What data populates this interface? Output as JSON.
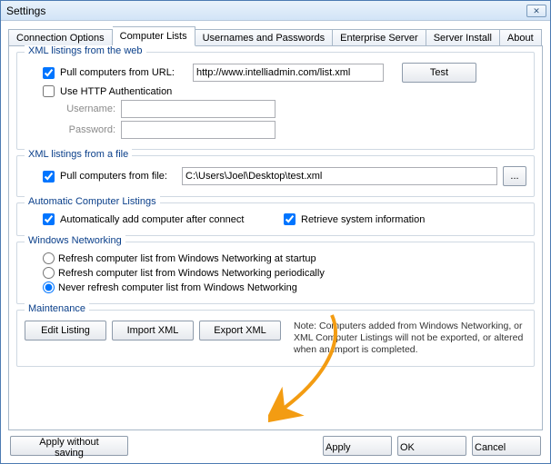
{
  "window": {
    "title": "Settings"
  },
  "tabs": [
    {
      "label": "Connection Options"
    },
    {
      "label": "Computer Lists"
    },
    {
      "label": "Usernames and Passwords"
    },
    {
      "label": "Enterprise Server"
    },
    {
      "label": "Server Install"
    },
    {
      "label": "About"
    }
  ],
  "web": {
    "legend": "XML listings from the web",
    "pull_label": "Pull computers from URL:",
    "url_value": "http://www.intelliadmin.com/list.xml",
    "test_label": "Test",
    "http_auth_label": "Use HTTP Authentication",
    "username_label": "Username:",
    "password_label": "Password:"
  },
  "file": {
    "legend": "XML listings from a file",
    "pull_label": "Pull computers from file:",
    "path_value": "C:\\Users\\Joel\\Desktop\\test.xml",
    "browse_label": "..."
  },
  "auto": {
    "legend": "Automatic Computer Listings",
    "auto_add_label": "Automatically add computer after connect",
    "retrieve_label": "Retrieve system information"
  },
  "net": {
    "legend": "Windows Networking",
    "opt_startup": "Refresh computer list from Windows Networking at startup",
    "opt_periodic": "Refresh computer list from Windows Networking periodically",
    "opt_never": "Never refresh computer list from Windows Networking"
  },
  "maint": {
    "legend": "Maintenance",
    "edit_label": "Edit Listing",
    "import_label": "Import XML",
    "export_label": "Export XML",
    "note": "Note: Computers added from Windows Networking, or XML Computer Listings will not be exported, or altered when an import is completed."
  },
  "footer": {
    "apply_without": "Apply without saving",
    "apply": "Apply",
    "ok": "OK",
    "cancel": "Cancel"
  }
}
